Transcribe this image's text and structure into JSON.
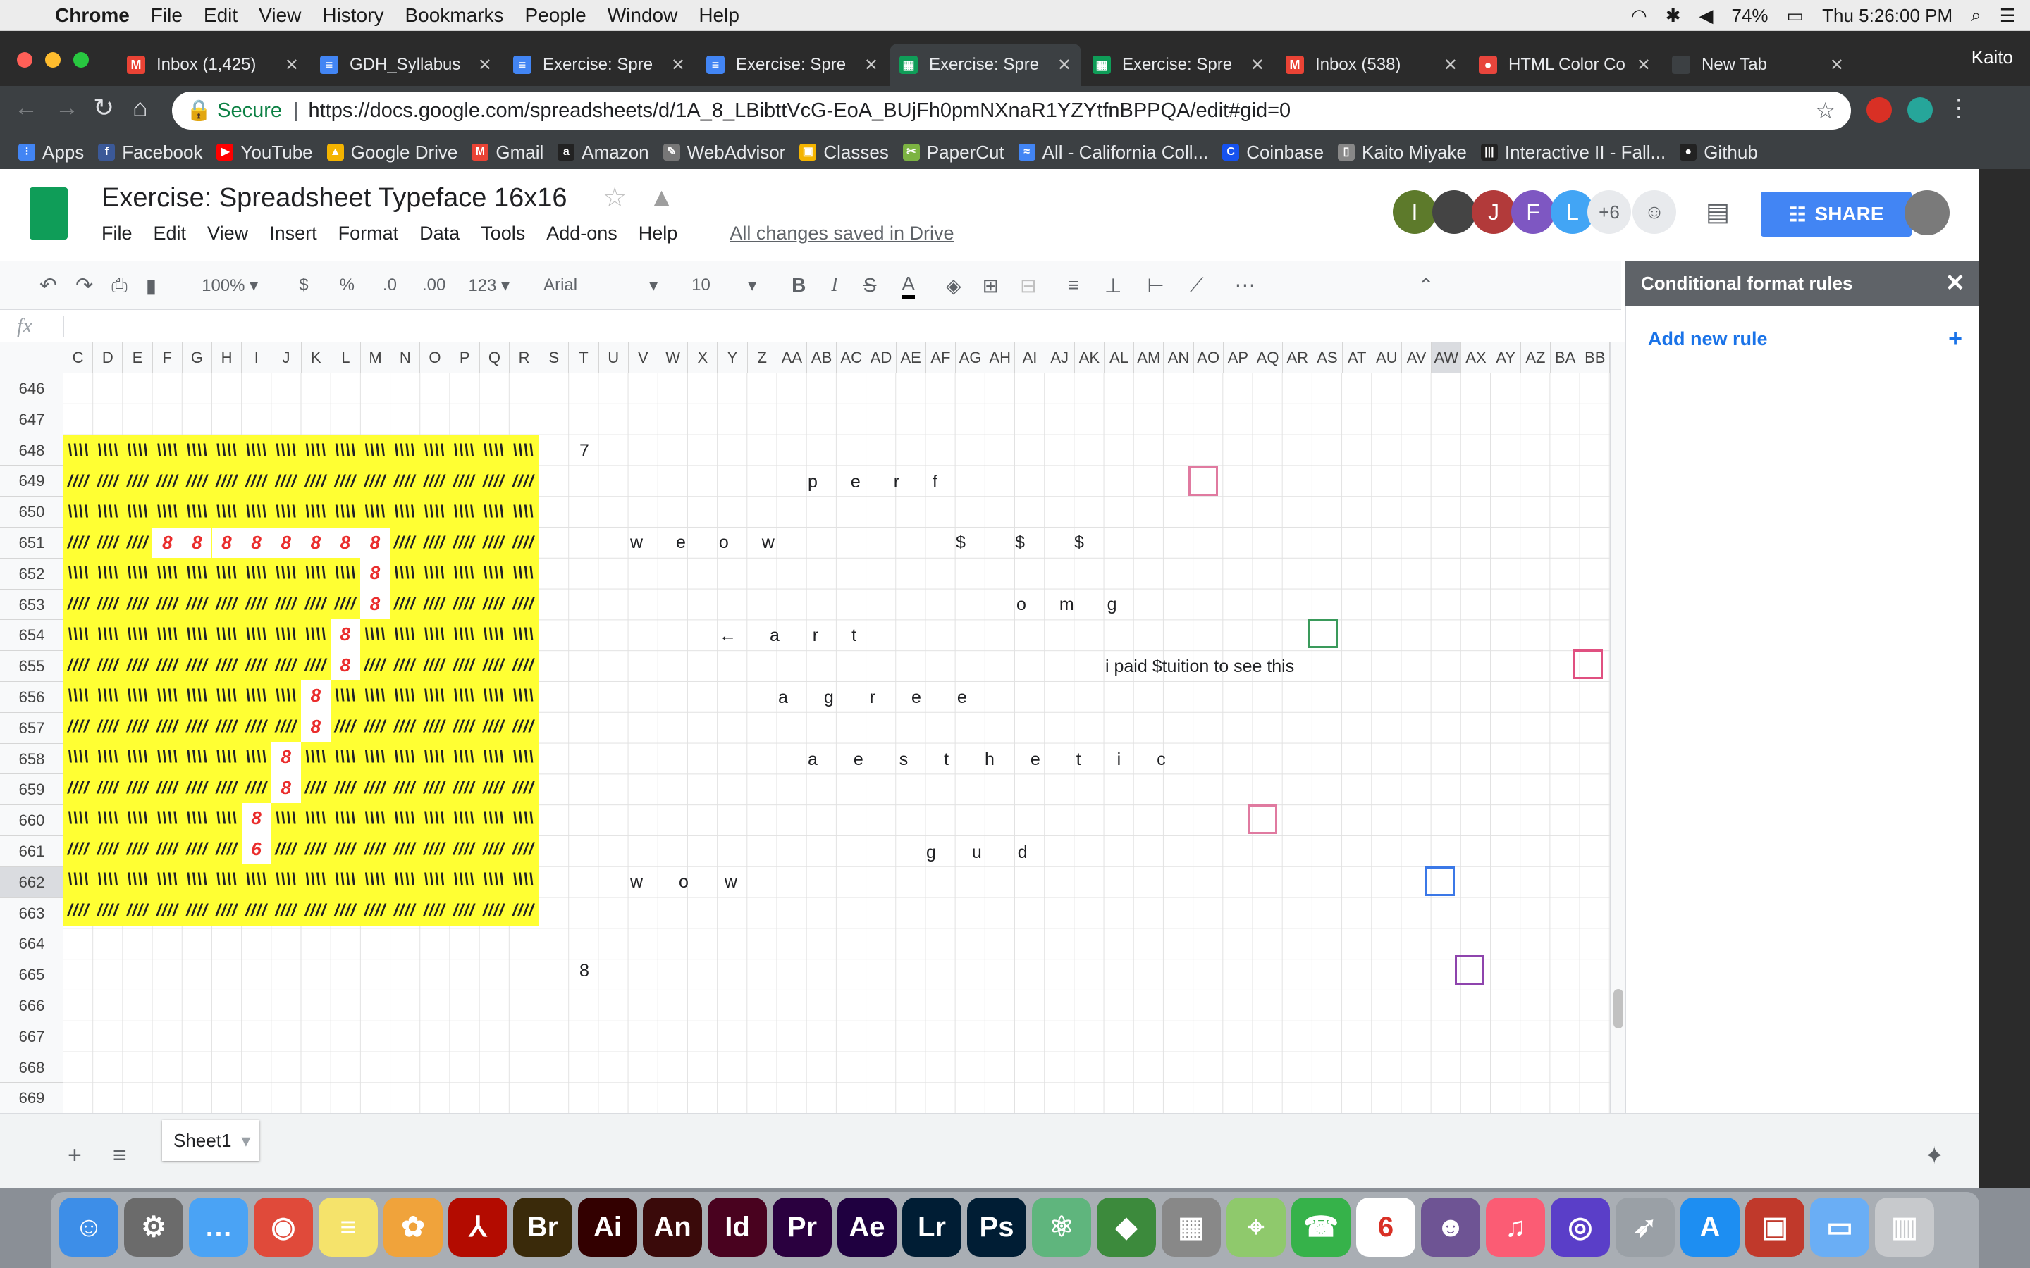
{
  "menubar": {
    "app": "Chrome",
    "items": [
      "File",
      "Edit",
      "View",
      "History",
      "Bookmarks",
      "People",
      "Window",
      "Help"
    ],
    "battery": "74%",
    "clock": "Thu 5:26:00 PM"
  },
  "tabs": [
    {
      "label": "Inbox (1,425)",
      "color": "#ea4335",
      "glyph": "M"
    },
    {
      "label": "GDH_Syllabus",
      "color": "#4285f4",
      "glyph": "≡"
    },
    {
      "label": "Exercise: Spre",
      "color": "#4285f4",
      "glyph": "≡"
    },
    {
      "label": "Exercise: Spre",
      "color": "#4285f4",
      "glyph": "≡"
    },
    {
      "label": "Exercise: Spre",
      "color": "#0f9d58",
      "glyph": "▦"
    },
    {
      "label": "Exercise: Spre",
      "color": "#0f9d58",
      "glyph": "▦"
    },
    {
      "label": "Inbox (538)",
      "color": "#ea4335",
      "glyph": "M"
    },
    {
      "label": "HTML Color Co",
      "color": "#e8453c",
      "glyph": "●"
    },
    {
      "label": "New Tab",
      "color": "#3c4043",
      "glyph": ""
    }
  ],
  "profile": "Kaito",
  "address": {
    "secure": "Secure",
    "url": "https://docs.google.com/spreadsheets/d/1A_8_LBibttVcG-EoA_BUjFh0pmNXnaR1YZYtfnBPPQA/edit#gid=0"
  },
  "bookmarks": [
    {
      "label": "Apps",
      "color": "#4285f4",
      "glyph": "⁝"
    },
    {
      "label": "Facebook",
      "color": "#3b5998",
      "glyph": "f"
    },
    {
      "label": "YouTube",
      "color": "#ff0000",
      "glyph": "▶"
    },
    {
      "label": "Google Drive",
      "color": "#f4b400",
      "glyph": "▲"
    },
    {
      "label": "Gmail",
      "color": "#ea4335",
      "glyph": "M"
    },
    {
      "label": "Amazon",
      "color": "#222222",
      "glyph": "a"
    },
    {
      "label": "WebAdvisor",
      "color": "#777777",
      "glyph": "✎"
    },
    {
      "label": "Classes",
      "color": "#f4b400",
      "glyph": "▣"
    },
    {
      "label": "PaperCut",
      "color": "#7cb342",
      "glyph": "✂"
    },
    {
      "label": "All - California Coll...",
      "color": "#4285f4",
      "glyph": "≈"
    },
    {
      "label": "Coinbase",
      "color": "#1652f0",
      "glyph": "C"
    },
    {
      "label": "Kaito Miyake",
      "color": "#888888",
      "glyph": "▯"
    },
    {
      "label": "Interactive II - Fall...",
      "color": "#222222",
      "glyph": "|||"
    },
    {
      "label": "Github",
      "color": "#222222",
      "glyph": "●"
    }
  ],
  "doc": {
    "title": "Exercise: Spreadsheet Typeface 16x16",
    "menu": [
      "File",
      "Edit",
      "View",
      "Insert",
      "Format",
      "Data",
      "Tools",
      "Add-ons",
      "Help"
    ],
    "saved": "All changes saved in Drive",
    "share": "SHARE",
    "more_count": "+6",
    "avatars": [
      {
        "letter": "I",
        "color": "#5d7a2b"
      },
      {
        "letter": "",
        "color": "#444444"
      },
      {
        "letter": "J",
        "color": "#b23a3a"
      },
      {
        "letter": "F",
        "color": "#7e57c2"
      },
      {
        "letter": "L",
        "color": "#42a5f5"
      }
    ]
  },
  "toolbar": {
    "zoom": "100%",
    "currency": "$",
    "percent": "%",
    "dec_less": ".0",
    "dec_more": ".00",
    "format": "123",
    "font": "Arial",
    "size": "10",
    "bold": "B",
    "italic": "I",
    "strike": "S",
    "textcolor": "A"
  },
  "fx": "fx",
  "columns": [
    "C",
    "D",
    "E",
    "F",
    "G",
    "H",
    "I",
    "J",
    "K",
    "L",
    "M",
    "N",
    "O",
    "P",
    "Q",
    "R",
    "S",
    "T",
    "U",
    "V",
    "W",
    "X",
    "Y",
    "Z",
    "AA",
    "AB",
    "AC",
    "AD",
    "AE",
    "AF",
    "AG",
    "AH",
    "AI",
    "AJ",
    "AK",
    "AL",
    "AM",
    "AN",
    "AO",
    "AP",
    "AQ",
    "AR",
    "AS",
    "AT",
    "AU",
    "AV",
    "AW",
    "AX",
    "AY",
    "AZ",
    "BA",
    "BB"
  ],
  "rows": [
    "646",
    "647",
    "648",
    "649",
    "650",
    "651",
    "652",
    "653",
    "654",
    "655",
    "656",
    "657",
    "658",
    "659",
    "660",
    "661",
    "662",
    "663",
    "664",
    "665",
    "666",
    "667",
    "668",
    "669"
  ],
  "pattern_rows": [
    "\\\\\\\\ \\\\\\\\ \\\\\\\\ \\\\\\\\ \\\\\\\\ \\\\\\\\ \\\\\\\\ \\\\\\\\ \\\\\\\\ \\\\\\\\ \\\\\\\\ \\\\\\\\ \\\\\\\\ \\\\\\\\ \\\\\\\\ \\\\\\\\",
    "//// //// //// //// //// //// //// //// //// //// //// //// //// //// //// ////"
  ],
  "cells": {
    "t648": "7",
    "perf": "p e r f",
    "weow": "w e o w",
    "dollar": "$",
    "omg": "o m g",
    "art": "← a r t",
    "tuition": "i paid $tuition to see this",
    "agree": "a g r e e",
    "aesthetic": "a e s t h e t i c",
    "gud": "g u d",
    "wow": "w o w",
    "t665": "8"
  },
  "marks": {
    "glyph": "8",
    "last_glyph": "6"
  },
  "panel": {
    "title": "Conditional format rules",
    "add": "Add new rule"
  },
  "sheet": {
    "name": "Sheet1",
    "add": "+",
    "list": "≡"
  },
  "dock": [
    {
      "label": "Finder",
      "color": "#3d8ee8",
      "glyph": "☺"
    },
    {
      "label": "Prefs",
      "color": "#6b6b6b",
      "glyph": "⚙"
    },
    {
      "label": "Messages",
      "color": "#4aa3f5",
      "glyph": "…"
    },
    {
      "label": "Chrome",
      "color": "#e04a3a",
      "glyph": "◉"
    },
    {
      "label": "Notes",
      "color": "#f5e36b",
      "glyph": "≡"
    },
    {
      "label": "Photos",
      "color": "#f0a33b",
      "glyph": "✿"
    },
    {
      "label": "Acrobat",
      "color": "#b30b00",
      "glyph": "⅄"
    },
    {
      "label": "Bridge",
      "color": "#3a2a0a",
      "glyph": "Br"
    },
    {
      "label": "Illustrator",
      "color": "#330000",
      "glyph": "Ai"
    },
    {
      "label": "Animate",
      "color": "#3a0a0a",
      "glyph": "An"
    },
    {
      "label": "InDesign",
      "color": "#49021f",
      "glyph": "Id"
    },
    {
      "label": "Premiere",
      "color": "#2a003f",
      "glyph": "Pr"
    },
    {
      "label": "AfterEffects",
      "color": "#1f0040",
      "glyph": "Ae"
    },
    {
      "label": "Lightroom",
      "color": "#001d34",
      "glyph": "Lr"
    },
    {
      "label": "Photoshop",
      "color": "#001d34",
      "glyph": "Ps"
    },
    {
      "label": "Atom",
      "color": "#5fb57d",
      "glyph": "⚛"
    },
    {
      "label": "Maps",
      "color": "#3c8a3c",
      "glyph": "◆"
    },
    {
      "label": "Calc",
      "color": "#888888",
      "glyph": "▦"
    },
    {
      "label": "Maps2",
      "color": "#8fc96c",
      "glyph": "⌖"
    },
    {
      "label": "FaceTime",
      "color": "#36b24a",
      "glyph": "☎"
    },
    {
      "label": "Calendar",
      "color": "#ffffff",
      "glyph": "6"
    },
    {
      "label": "GitHub",
      "color": "#6e5494",
      "glyph": "☻"
    },
    {
      "label": "Music",
      "color": "#fb5c74",
      "glyph": "♫"
    },
    {
      "label": "Siri",
      "color": "#5a3ec8",
      "glyph": "◎"
    },
    {
      "label": "Launchpad",
      "color": "#9aa0a6",
      "glyph": "➶"
    },
    {
      "label": "AppStore",
      "color": "#1d8ef2",
      "glyph": "A"
    },
    {
      "label": "PhotoBooth",
      "color": "#c0392b",
      "glyph": "▣"
    },
    {
      "label": "Folder",
      "color": "#6aaef5",
      "glyph": "▭"
    },
    {
      "label": "Trash",
      "color": "#c7c9cc",
      "glyph": "▥"
    }
  ]
}
